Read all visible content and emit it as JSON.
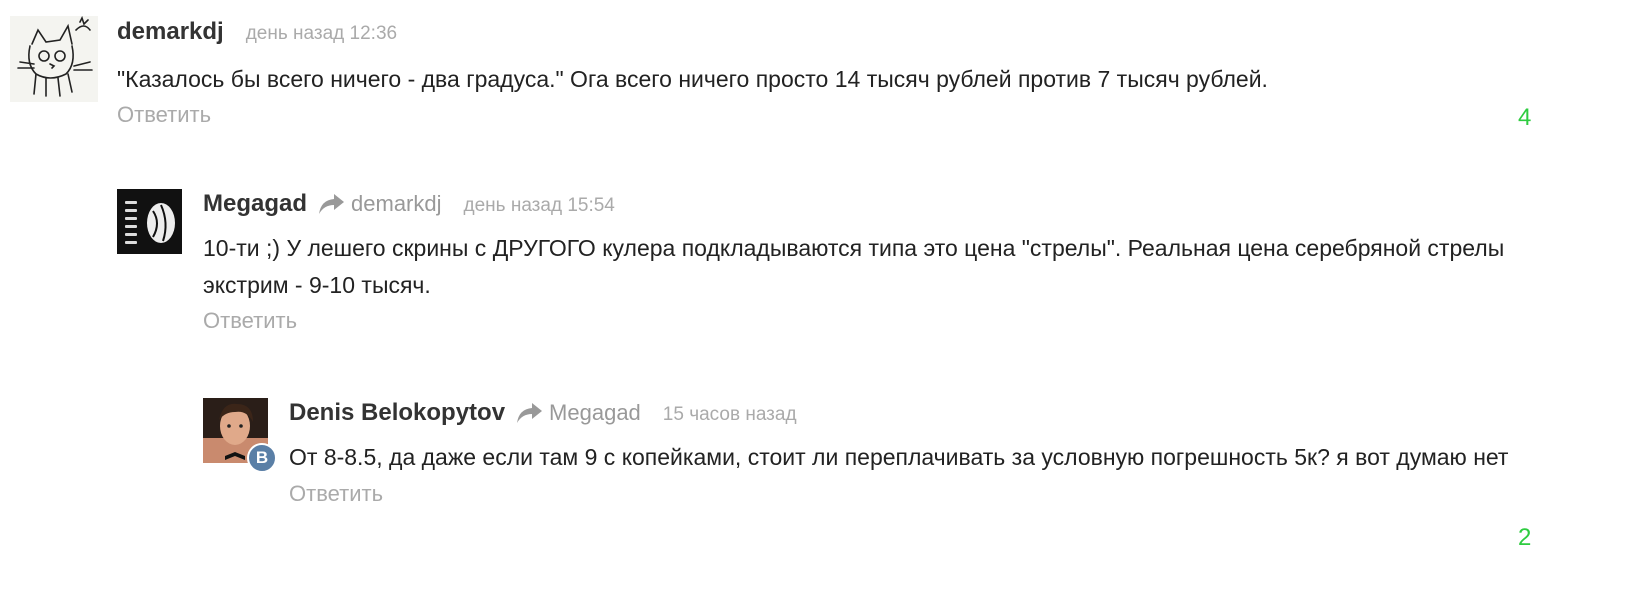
{
  "colors": {
    "score": "#2ecc40",
    "muted": "#aaaaaa",
    "author": "#333333"
  },
  "comments": [
    {
      "author": "demarkdj",
      "reply_to": "",
      "time": "день назад 12:36",
      "text": "\"Казалось бы всего ничего - два градуса.\" Ога всего ничего просто 14 тысяч рублей против 7 тысяч рублей.",
      "reply_label": "Ответить",
      "score": "4",
      "avatar_icon": "sketch-cat-avatar"
    },
    {
      "author": "Megagad",
      "reply_to": "demarkdj",
      "time": "день назад 15:54",
      "text": "10-ти ;) У лешего скрины с ДРУГОГО кулера подкладываются типа это цена \"стрелы\". Реальная цена серебряной стрелы экстрим - 9-10 тысяч.",
      "reply_label": "Ответить",
      "score": "",
      "avatar_icon": "dark-abstract-avatar"
    },
    {
      "author": "Denis Belokopytov",
      "reply_to": "Megagad",
      "time": "15 часов назад",
      "text": "От 8-8.5, да даже если там 9 с копейками, стоит ли переплачивать за условную погрешность 5к? я вот думаю нет",
      "reply_label": "Ответить",
      "score": "2",
      "avatar_icon": "person-photo-avatar",
      "badge": "B"
    }
  ]
}
